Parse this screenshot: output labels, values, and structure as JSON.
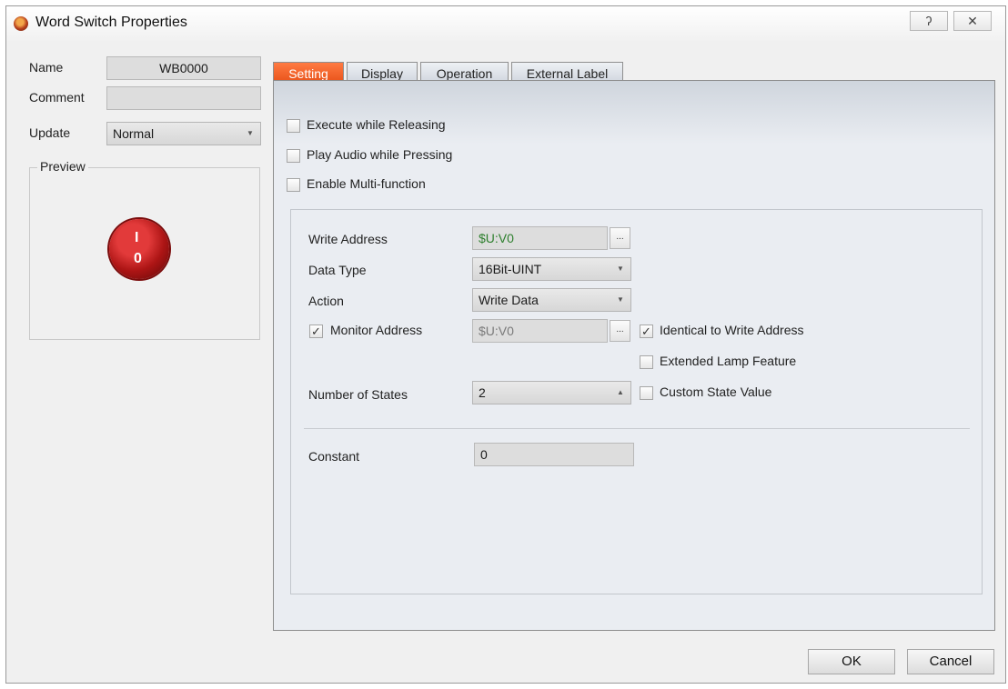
{
  "window": {
    "title": "Word Switch Properties",
    "help_symbol": "ʔ",
    "close_symbol": "✕"
  },
  "left": {
    "name_label": "Name",
    "name_value": "WB0000",
    "comment_label": "Comment",
    "comment_value": "",
    "update_label": "Update",
    "update_value": "Normal",
    "preview_label": "Preview",
    "switch_top": "I",
    "switch_bottom": "0"
  },
  "tabs": [
    {
      "label": "Setting",
      "active": true
    },
    {
      "label": "Display",
      "active": false
    },
    {
      "label": "Operation",
      "active": false
    },
    {
      "label": "External Label",
      "active": false
    }
  ],
  "setting": {
    "options": [
      {
        "label": "Execute while Releasing",
        "checked": false
      },
      {
        "label": "Play Audio while Pressing",
        "checked": false
      },
      {
        "label": "Enable Multi-function",
        "checked": false
      }
    ],
    "write_address": {
      "label": "Write Address",
      "value": "$U:V0",
      "button": "..."
    },
    "data_type": {
      "label": "Data Type",
      "value": "16Bit-UINT"
    },
    "action": {
      "label": "Action",
      "value": "Write Data"
    },
    "monitor_address": {
      "label": "Monitor Address",
      "checked": true,
      "value": "$U:V0",
      "button": "..."
    },
    "identical_to_write": {
      "label": "Identical to Write Address",
      "checked": true
    },
    "extended_lamp": {
      "label": "Extended Lamp Feature",
      "checked": false
    },
    "number_of_states": {
      "label": "Number of States",
      "value": "2"
    },
    "custom_state_value": {
      "label": "Custom State Value",
      "checked": false
    },
    "constant": {
      "label": "Constant",
      "value": "0"
    }
  },
  "buttons": {
    "ok": "OK",
    "cancel": "Cancel"
  },
  "colors": {
    "active_tab": "#e8561a",
    "address_text": "#2d7f2d",
    "disabled_text": "#7a7a7a"
  }
}
